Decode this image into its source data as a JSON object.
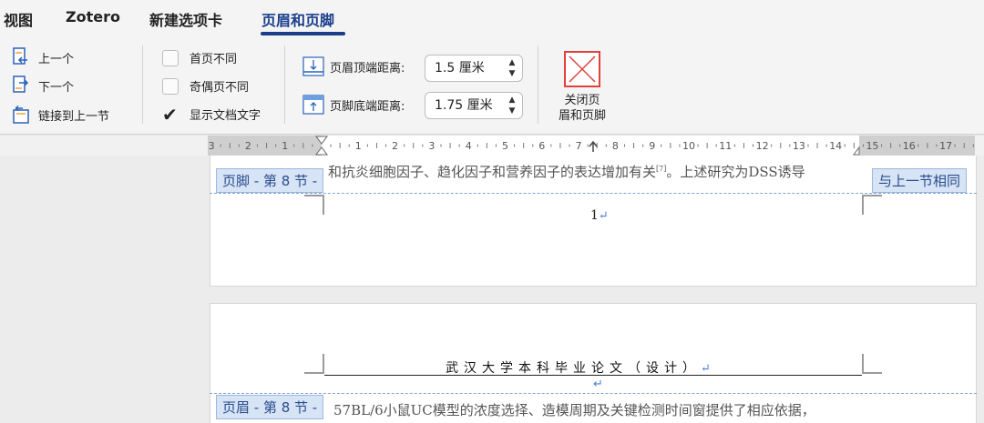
{
  "tabs": [
    {
      "label": "视图",
      "active": false
    },
    {
      "label": "Zotero",
      "active": false
    },
    {
      "label": "新建选项卡",
      "active": false
    },
    {
      "label": "页眉和页脚",
      "active": true
    }
  ],
  "nav": {
    "previous": "上一个",
    "next": "下一个",
    "link_previous": "链接到上一节"
  },
  "options": {
    "different_first": {
      "label": "首页不同",
      "checked": false
    },
    "different_odd_even": {
      "label": "奇偶页不同",
      "checked": false
    },
    "show_doc_text": {
      "label": "显示文档文字",
      "checked": true
    }
  },
  "position": {
    "header_top_label": "页眉顶端距离:",
    "header_top_value": "1.5 厘米",
    "footer_bottom_label": "页脚底端距离:",
    "footer_bottom_value": "1.75 厘米"
  },
  "close": {
    "line1": "关闭页",
    "line2": "眉和页脚"
  },
  "ruler": {
    "left_numbers": [
      "3",
      "2",
      "1"
    ],
    "right_numbers": [
      "1",
      "2",
      "3",
      "4",
      "5",
      "6",
      "7",
      "8",
      "9",
      "10",
      "11",
      "12",
      "13",
      "14",
      "15",
      "16",
      "17"
    ]
  },
  "page1": {
    "body_text": "和抗炎细胞因子、趋化因子和营养因子的表达增加有关",
    "citation": "[7]",
    "body_text_tail": "。上述研究为DSS诱导",
    "footer_tag": "页脚 - 第 8 节 -",
    "same_as_previous": "与上一节相同",
    "page_number": "1"
  },
  "page2": {
    "header_title": "武汉大学本科毕业论文（设计）",
    "header_tag": "页眉 - 第 8 节 -",
    "body_text": "57BL/6小鼠UC模型的浓度选择、造模周期及关键检测时间窗提供了相应依据，"
  },
  "symbols": {
    "return_mark": "↵",
    "check": "✔",
    "spin": "⌃⌄"
  },
  "colors": {
    "accent": "#1a3e8a",
    "close_red": "#e0413b",
    "tag_bg": "#d6e4f6"
  }
}
